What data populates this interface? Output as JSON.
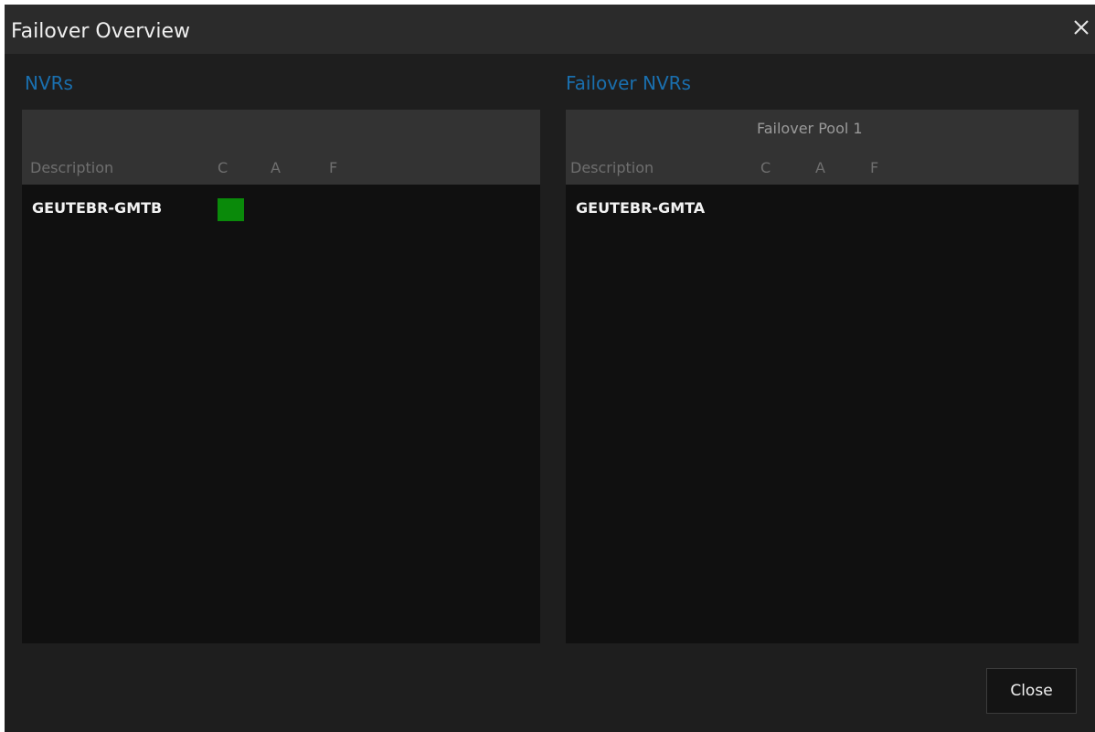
{
  "window": {
    "title": "Failover Overview"
  },
  "nvrs_panel": {
    "title": "NVRs",
    "columns": {
      "description": "Description",
      "c": "C",
      "a": "A",
      "f": "F"
    },
    "rows": [
      {
        "description": "GEUTEBR-GMTB",
        "c_status_color": "#0a8a0a"
      }
    ]
  },
  "failover_panel": {
    "title": "Failover NVRs",
    "pool_name": "Failover Pool 1",
    "columns": {
      "description": "Description",
      "c": "C",
      "a": "A",
      "f": "F"
    },
    "rows": [
      {
        "description": "GEUTEBR-GMTA"
      }
    ]
  },
  "footer": {
    "close_label": "Close"
  },
  "icons": {
    "close": "close-icon"
  },
  "colors": {
    "accent": "#1a6fae",
    "status_ok": "#0a8a0a"
  }
}
